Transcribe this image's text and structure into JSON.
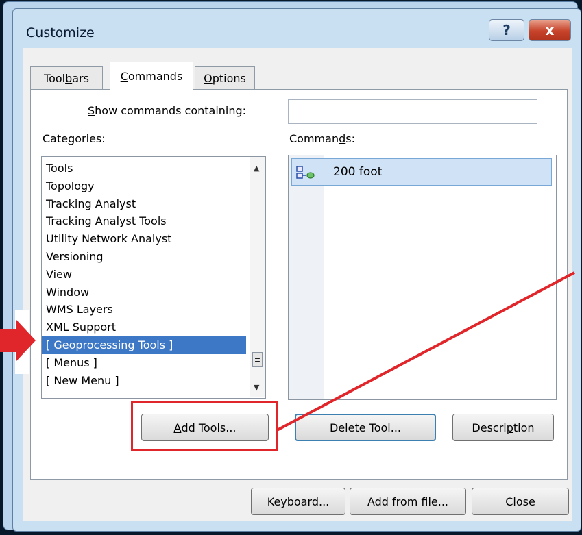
{
  "window": {
    "title": "Customize"
  },
  "titlebar": {
    "help_label": "?",
    "close_label": "x"
  },
  "tabs": [
    {
      "id": "toolbars",
      "label_pre": "Tool",
      "label_u": "b",
      "label_post": "ars"
    },
    {
      "id": "commands",
      "label_pre": "",
      "label_u": "C",
      "label_post": "ommands"
    },
    {
      "id": "options",
      "label_pre": "",
      "label_u": "O",
      "label_post": "ptions"
    }
  ],
  "search": {
    "label_pre": "",
    "label_u": "S",
    "label_post": "how commands containing:",
    "value": ""
  },
  "categories": {
    "label_pre": "Cate",
    "label_u": "g",
    "label_post": "ories:",
    "items": [
      "Tools",
      "Topology",
      "Tracking Analyst",
      "Tracking Analyst Tools",
      "Utility Network Analyst",
      "Versioning",
      "View",
      "Window",
      "WMS Layers",
      "XML Support",
      "[ Geoprocessing Tools ]",
      "[ Menus ]",
      "[ New Menu ]"
    ],
    "selected": "[ Geoprocessing Tools ]"
  },
  "commands": {
    "label_pre": "Comman",
    "label_u": "d",
    "label_post": "s:",
    "items": [
      {
        "label": "200 foot",
        "icon": "model-tool-icon"
      }
    ]
  },
  "buttons": {
    "add_tools_u": "A",
    "add_tools_post": "dd Tools...",
    "delete_tool": "Delete Tool...",
    "description_pre": "Descri",
    "description_u": "p",
    "description_post": "tion",
    "keyboard": "Keyboard...",
    "add_from_file": "Add from file...",
    "close": "Close"
  },
  "annotation": {
    "color": "#e0262a"
  },
  "colors": {
    "selection": "#3d78c6",
    "window_chrome": "#c9dff2",
    "background": "#07182b"
  }
}
